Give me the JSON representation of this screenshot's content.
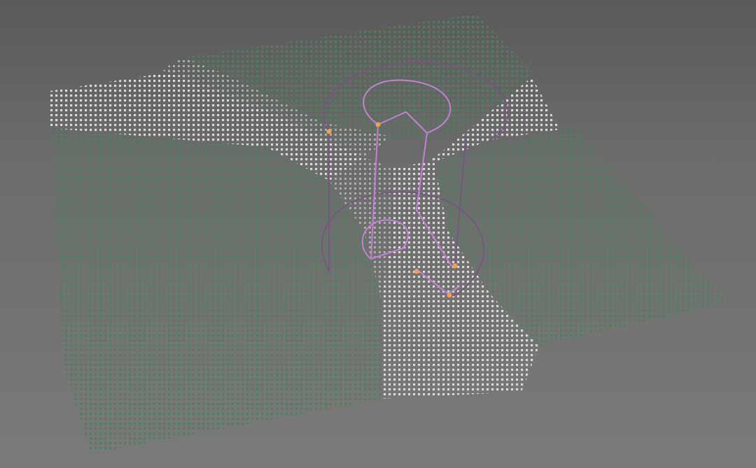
{
  "scene": {
    "background_color": "#6a6a6a",
    "surface_point_color": "#4f7f5c",
    "displaced_point_color": "#d6d6d6",
    "curve_color": "#c77fd6",
    "curve_dark_color": "#7c4f86",
    "control_point_color": "#f0a050",
    "icons": [
      "point-grid-surface",
      "spline-curve",
      "control-point"
    ]
  }
}
